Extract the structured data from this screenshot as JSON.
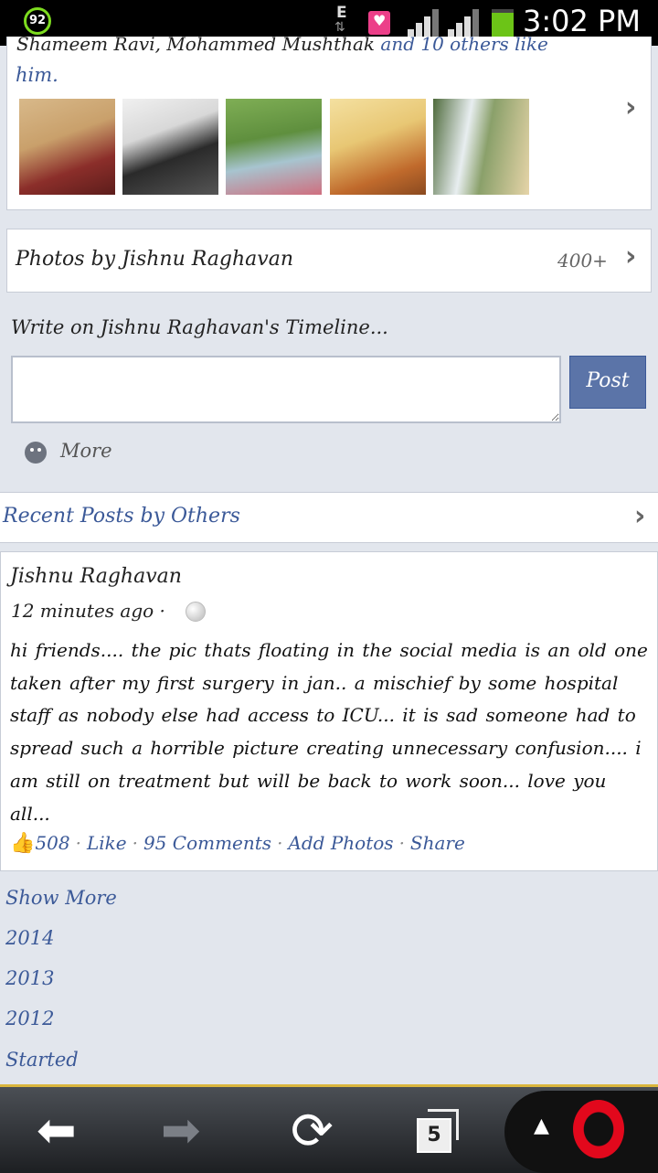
{
  "status_bar": {
    "battery_level_badge": "92",
    "network_type": "E",
    "network_arrows": "⇅",
    "time": "3:02 PM",
    "colors": {
      "battery_ring": "#7ddc1f",
      "battery_fill": "#6cc417",
      "notification": "#ec3f89"
    }
  },
  "friends": {
    "partial_line": "Shameem Ravi, Mohammed Mushthak and 10 others like",
    "names_part": "Shameem Ravi, Mohammed Mushthak",
    "and_others": "and 10 others like",
    "line2": "him.",
    "thumbnails": [
      {
        "name": "friend-photo-1",
        "colors": [
          "#c9a06b",
          "#8b2e2a"
        ]
      },
      {
        "name": "friend-photo-2",
        "colors": [
          "#d8d8d8",
          "#2a2a2a"
        ]
      },
      {
        "name": "friend-photo-3",
        "colors": [
          "#5f8f3e",
          "#cf6f7f"
        ]
      },
      {
        "name": "friend-photo-4",
        "colors": [
          "#e8c774",
          "#c06a2c"
        ]
      },
      {
        "name": "friend-photo-5",
        "colors": [
          "#4f6b3c",
          "#e6d4a8"
        ]
      }
    ]
  },
  "photos": {
    "title": "Photos by Jishnu Raghavan",
    "count": "400+"
  },
  "composer": {
    "label": "Write on Jishnu Raghavan's Timeline...",
    "input_value": "",
    "post_button": "Post",
    "more": "More"
  },
  "recent_posts": {
    "title": "Recent Posts by Others"
  },
  "post": {
    "author": "Jishnu Raghavan",
    "time": "12 minutes ago ·",
    "text": "hi friends.... the  pic thats floating in the social media is an old one taken after my first surgery in  jan.. a mischief  by  some hospital staff as nobody else had access to ICU... it is sad someone had to spread such a horrible picture creating unnecessary confusion.... i am still on treatment but will be back to work soon... love you all...",
    "likes": "508",
    "like_label": "Like",
    "comments": "95 Comments",
    "add_photos": "Add Photos",
    "share": "Share"
  },
  "timeline_nav": {
    "show_more": "Show More",
    "y2014": "2014",
    "y2013": "2013",
    "y2012": "2012",
    "started": "Started"
  },
  "browser_bar": {
    "tab_count": "5",
    "colors": {
      "accent": "#d9b53c",
      "opera_red": "#e2081c"
    }
  }
}
